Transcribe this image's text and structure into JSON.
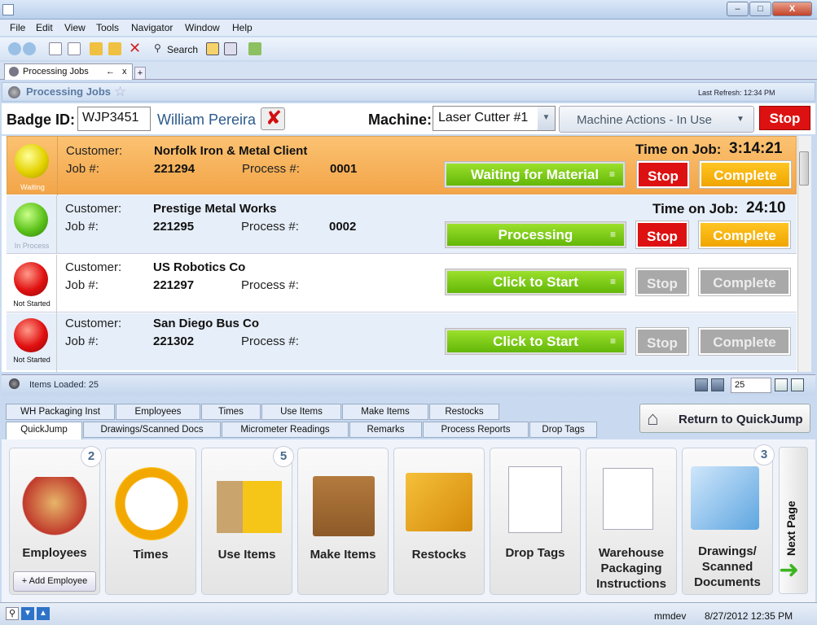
{
  "menu": [
    "File",
    "Edit",
    "View",
    "Tools",
    "Navigator",
    "Window",
    "Help"
  ],
  "toolbar": {
    "search_label": "Search"
  },
  "doc_tab": {
    "label": "Processing Jobs",
    "pin": "←",
    "close": "x",
    "add": "+"
  },
  "panel": {
    "title": "Processing Jobs",
    "last_refresh": "Last Refresh: 12:34 PM"
  },
  "badge": {
    "label": "Badge ID:",
    "value": "WJP3451",
    "name": "William Pereira"
  },
  "machine": {
    "label": "Machine:",
    "value": "Laser Cutter #1",
    "actions": "Machine Actions - In Use",
    "stop": "Stop"
  },
  "labels": {
    "customer": "Customer:",
    "job": "Job #:",
    "process": "Process #:",
    "time_on_job": "Time on Job:",
    "stop": "Stop",
    "complete": "Complete"
  },
  "jobs": [
    {
      "status": "Waiting",
      "customer": "Norfolk Iron & Metal Client",
      "job": "221294",
      "process": "0001",
      "time": "3:14:21",
      "action": "Waiting for Material"
    },
    {
      "status": "In Process",
      "customer": "Prestige Metal Works",
      "job": "221295",
      "process": "0002",
      "time": "24:10",
      "action": "Processing"
    },
    {
      "status": "Not Started",
      "customer": "US Robotics Co",
      "job": "221297",
      "process": "",
      "time": "",
      "action": "Click to Start"
    },
    {
      "status": "Not Started",
      "customer": "San Diego Bus Co",
      "job": "221302",
      "process": "",
      "time": "",
      "action": "Click to Start"
    }
  ],
  "items_loaded": "Items Loaded:  25",
  "page_size": "25",
  "tabs_row1": [
    "WH Packaging Inst",
    "Employees",
    "Times",
    "Use Items",
    "Make Items",
    "Restocks"
  ],
  "tabs_row2": [
    "QuickJump",
    "Drawings/Scanned Docs",
    "Micrometer Readings",
    "Remarks",
    "Process Reports",
    "Drop Tags"
  ],
  "return_label": "Return to QuickJump",
  "tiles": [
    {
      "label": "Employees",
      "badge": "2",
      "button": "+ Add Employee"
    },
    {
      "label": "Times",
      "badge": "",
      "button": ""
    },
    {
      "label": "Use Items",
      "badge": "5",
      "button": ""
    },
    {
      "label": "Make Items",
      "badge": "",
      "button": ""
    },
    {
      "label": "Restocks",
      "badge": "",
      "button": ""
    },
    {
      "label": "Drop Tags",
      "badge": "",
      "button": ""
    },
    {
      "label": "Warehouse Packaging Instructions",
      "badge": "",
      "button": ""
    },
    {
      "label": "Drawings/ Scanned Documents",
      "badge": "3",
      "button": ""
    }
  ],
  "next_page": "Next Page",
  "status": {
    "user": "mmdev",
    "datetime": "8/27/2012  12:35 PM"
  }
}
